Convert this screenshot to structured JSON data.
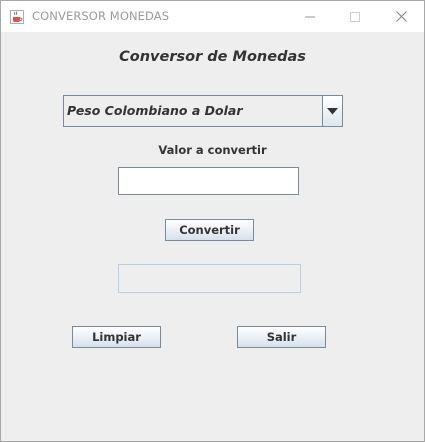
{
  "window": {
    "title": "CONVERSOR MONEDAS",
    "app_icon": "java-cup-icon",
    "controls": [
      "minimize-icon",
      "maximize-icon",
      "close-icon"
    ]
  },
  "form": {
    "heading": "Conversor de Monedas",
    "conversion_select": {
      "selected": "Peso Colombiano a Dolar"
    },
    "amount_label": "Valor a convertir",
    "amount_input": {
      "value": "",
      "placeholder": ""
    },
    "convert_button": "Convertir",
    "result_field": {
      "value": ""
    },
    "clear_button": "Limpiar",
    "exit_button": "Salir"
  },
  "colors": {
    "background": "#eeeeee",
    "border": "#7a8a99",
    "text": "#333333"
  }
}
